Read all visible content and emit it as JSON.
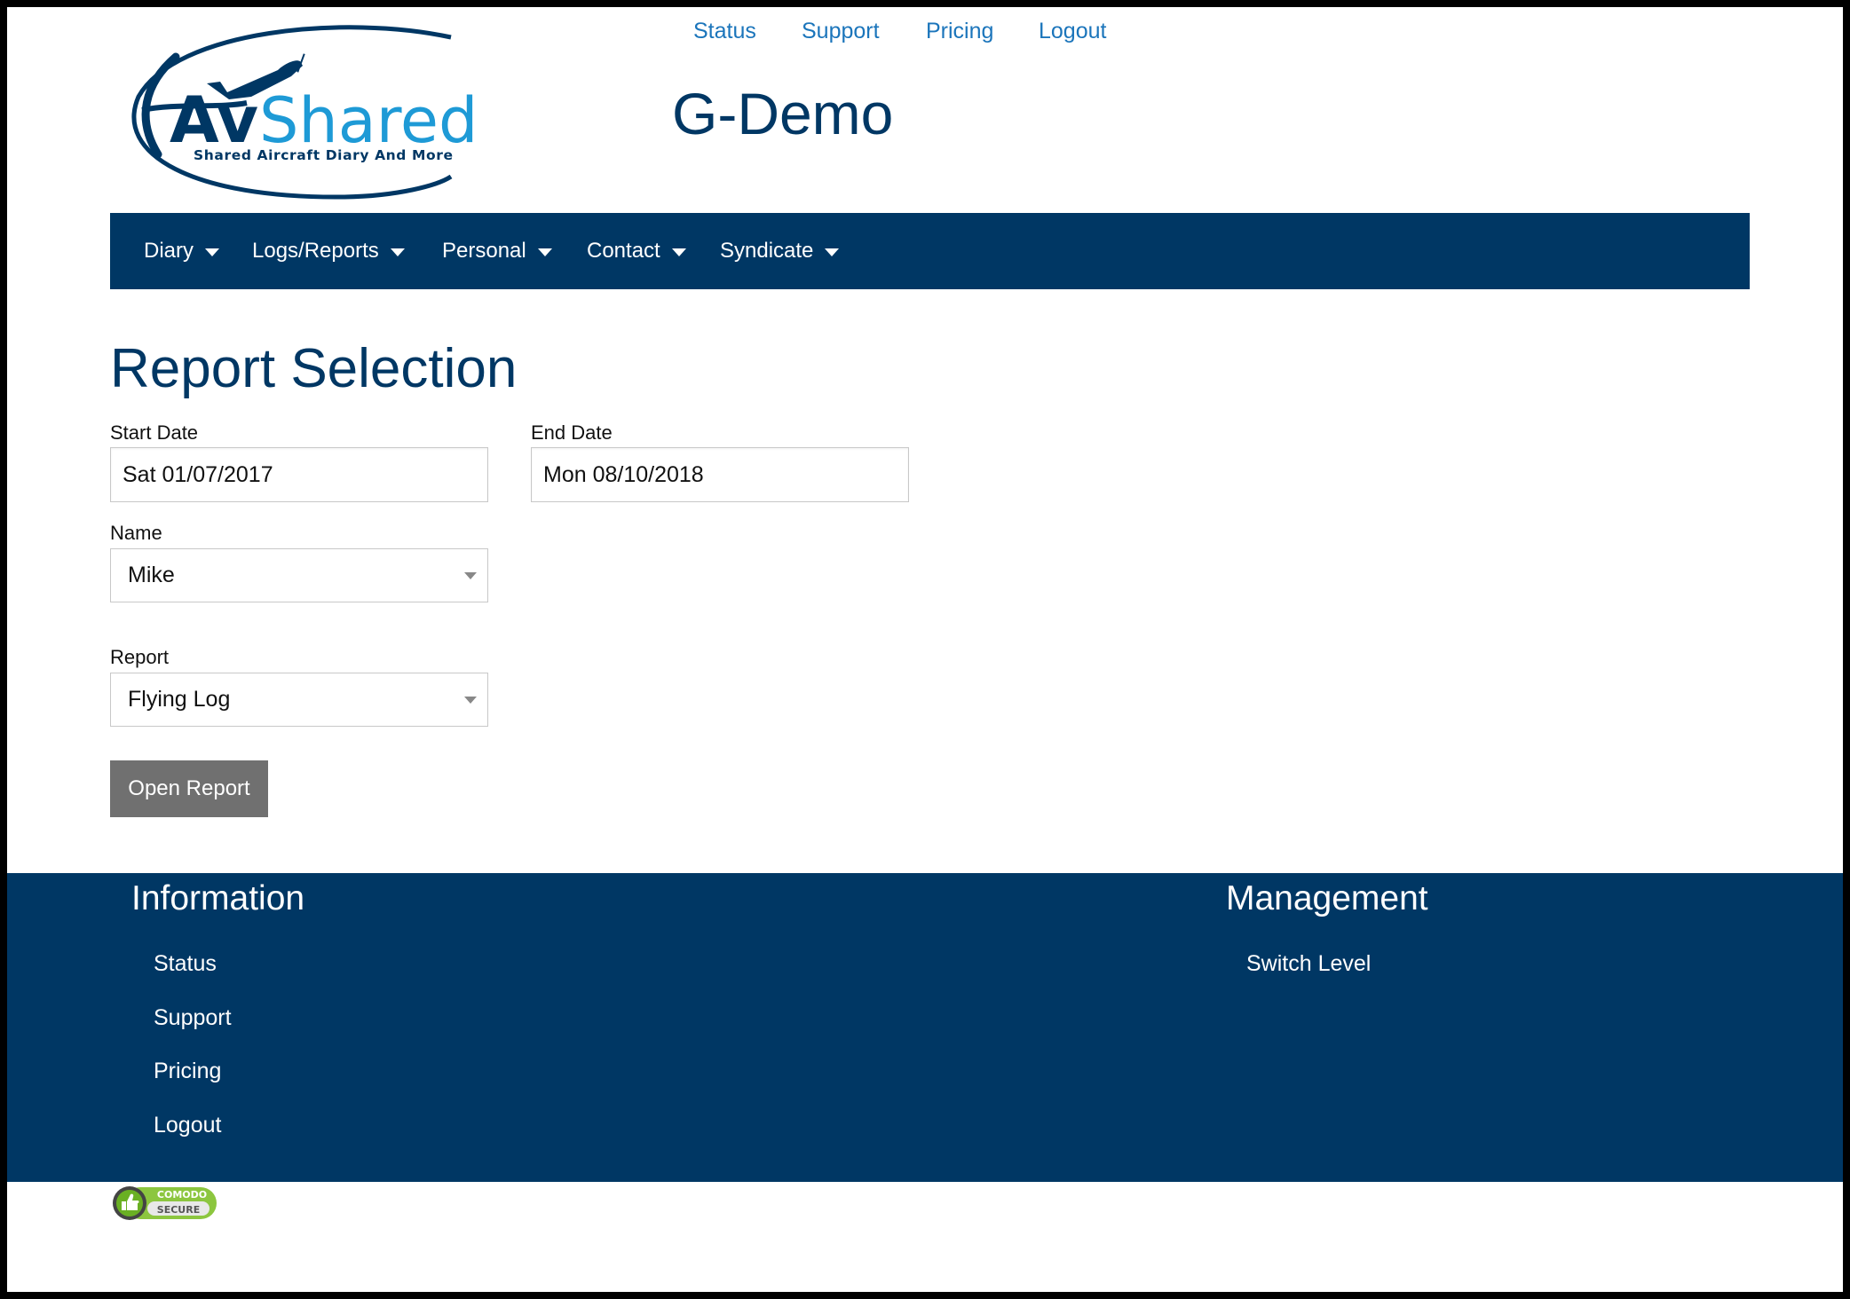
{
  "logo": {
    "brand_dark": "Av",
    "brand_light": "Shared",
    "tagline": "Shared Aircraft Diary And More",
    "icon": "airplane-icon"
  },
  "header": {
    "top_links": [
      "Status",
      "Support",
      "Pricing",
      "Logout"
    ],
    "site_title": "G-Demo"
  },
  "nav": {
    "items": [
      {
        "label": "Diary",
        "icon": "caret-down-icon"
      },
      {
        "label": "Logs/Reports",
        "icon": "caret-down-icon"
      },
      {
        "label": "Personal",
        "icon": "caret-down-icon"
      },
      {
        "label": "Contact",
        "icon": "caret-down-icon"
      },
      {
        "label": "Syndicate",
        "icon": "caret-down-icon"
      }
    ]
  },
  "main": {
    "title": "Report Selection",
    "start_date": {
      "label": "Start Date",
      "value": "Sat 01/07/2017"
    },
    "end_date": {
      "label": "End Date",
      "value": "Mon 08/10/2018"
    },
    "name": {
      "label": "Name",
      "value": "Mike"
    },
    "report": {
      "label": "Report",
      "value": "Flying Log"
    },
    "open_button": "Open Report"
  },
  "footer": {
    "information": {
      "title": "Information",
      "links": [
        "Status",
        "Support",
        "Pricing",
        "Logout"
      ]
    },
    "management": {
      "title": "Management",
      "links": [
        "Switch Level"
      ]
    }
  },
  "badge": {
    "line1": "COMODO",
    "line2": "SECURE"
  },
  "colors": {
    "primary_navy": "#003764",
    "link_blue": "#1b75bb",
    "logo_light_blue": "#1e9ad6",
    "button_gray": "#707070",
    "badge_green": "#8cc63f"
  }
}
